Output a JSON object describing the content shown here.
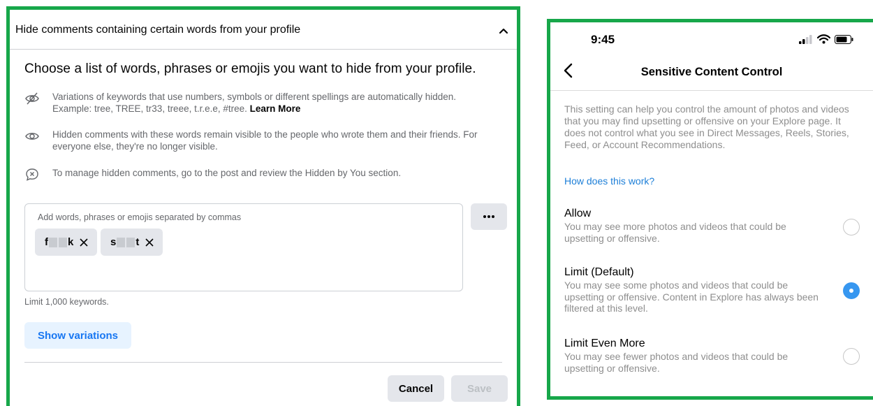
{
  "colors": {
    "frame": "#17a74a",
    "fb_blue": "#1877f2",
    "ig_blue": "#3797f0",
    "link_blue": "#1d7fd8"
  },
  "facebook": {
    "header": "Hide comments containing certain words from your profile",
    "title": "Choose a list of words, phrases or emojis you want to hide from your profile.",
    "info": [
      {
        "icon": "eye-slash-icon",
        "text": "Variations of keywords that use numbers, symbols or different spellings are automatically hidden. Example: tree, TREE, tr33, treee, t.r.e.e, #tree.",
        "link": "Learn More"
      },
      {
        "icon": "eye-icon",
        "text": "Hidden comments with these words remain visible to the people who wrote them and their friends. For everyone else, they're no longer visible."
      },
      {
        "icon": "comment-hide-icon",
        "text": "To manage hidden comments, go to the post and review the Hidden by You section."
      }
    ],
    "input_label": "Add words, phrases or emojis separated by commas",
    "chips": [
      {
        "start": "f",
        "end": "k"
      },
      {
        "start": "s",
        "end": "t"
      }
    ],
    "limit": "Limit 1,000 keywords.",
    "show_variations": "Show variations",
    "cancel": "Cancel",
    "save": "Save"
  },
  "instagram": {
    "time": "9:45",
    "title": "Sensitive Content Control",
    "description": "This setting can help you control the amount of photos and videos that you may find upsetting or offensive on your Explore page. It does not control what you see in Direct Messages, Reels, Stories, Feed, or Account Recommendations.",
    "link": "How does this work?",
    "options": [
      {
        "title": "Allow",
        "desc": "You may see more photos and videos that could be upsetting or offensive.",
        "selected": false
      },
      {
        "title": "Limit (Default)",
        "desc": "You may see some photos and videos that could be upsetting or offensive. Content in Explore has always been filtered at this level.",
        "selected": true
      },
      {
        "title": "Limit Even More",
        "desc": "You may see fewer photos and videos that could be upsetting or offensive.",
        "selected": false
      }
    ]
  }
}
